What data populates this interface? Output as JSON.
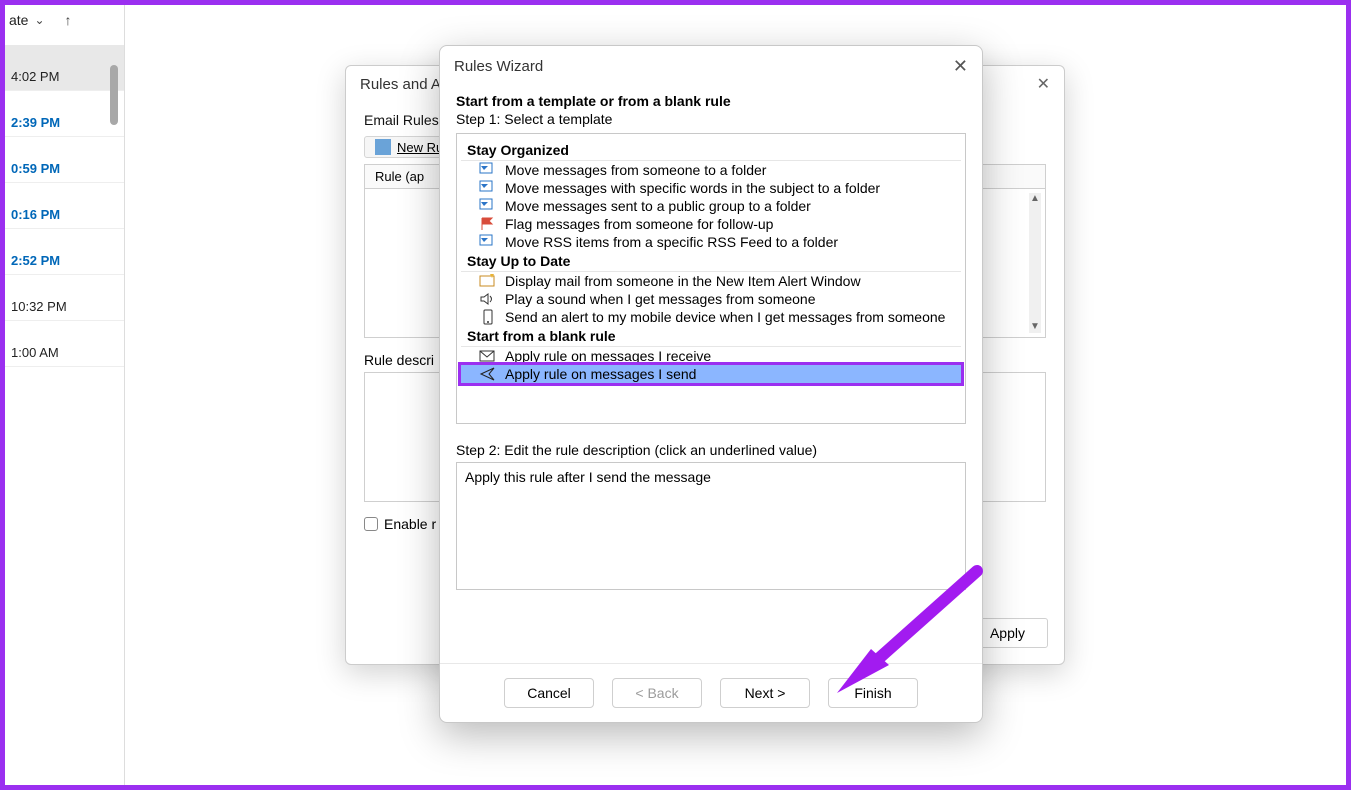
{
  "left": {
    "sort_label": "ate",
    "times": [
      "4:02 PM",
      "2:39 PM",
      "0:59 PM",
      "0:16 PM",
      "2:52 PM",
      "10:32 PM",
      "1:00 AM"
    ]
  },
  "rules_alerts": {
    "title": "Rules and Al",
    "tab_label": "Email Rules",
    "new_rule_btn": "New Ru",
    "rule_col": "Rule (ap",
    "desc_label": "Rule descri",
    "enable_label": "Enable r",
    "apply_btn": "Apply"
  },
  "wizard": {
    "title": "Rules Wizard",
    "heading1": "Start from a template or from a blank rule",
    "heading2": "Step 1: Select a template",
    "groups": {
      "g1": "Stay Organized",
      "g2": "Stay Up to Date",
      "g3": "Start from a blank rule"
    },
    "opts": {
      "o1": "Move messages from someone to a folder",
      "o2": "Move messages with specific words in the subject to a folder",
      "o3": "Move messages sent to a public group to a folder",
      "o4": "Flag messages from someone for follow-up",
      "o5": "Move RSS items from a specific RSS Feed to a folder",
      "o6": "Display mail from someone in the New Item Alert Window",
      "o7": "Play a sound when I get messages from someone",
      "o8": "Send an alert to my mobile device when I get messages from someone",
      "o9": "Apply rule on messages I receive",
      "o10": "Apply rule on messages I send"
    },
    "step2_label": "Step 2: Edit the rule description (click an underlined value)",
    "step2_desc": "Apply this rule after I send the message",
    "buttons": {
      "cancel": "Cancel",
      "back": "< Back",
      "next": "Next >",
      "finish": "Finish"
    }
  }
}
